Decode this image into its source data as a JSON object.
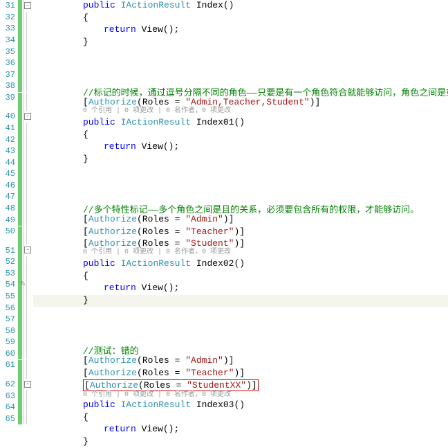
{
  "editor": {
    "lines": [
      {
        "num": 31,
        "type": "code",
        "indent": 2,
        "tokens": [
          [
            "kw",
            "public"
          ],
          [
            "punct",
            " "
          ],
          [
            "type",
            "IActionResult"
          ],
          [
            "punct",
            " "
          ],
          [
            "ident",
            "Index"
          ],
          [
            "punct",
            "()"
          ]
        ],
        "track": "green",
        "box": true
      },
      {
        "num": 32,
        "type": "code",
        "indent": 2,
        "tokens": [
          [
            "punct",
            "{"
          ]
        ],
        "track": "green"
      },
      {
        "num": 33,
        "type": "code",
        "indent": 3,
        "tokens": [
          [
            "kw",
            "return"
          ],
          [
            "punct",
            " "
          ],
          [
            "ident",
            "View"
          ],
          [
            "punct",
            "();"
          ]
        ],
        "track": "green"
      },
      {
        "num": 34,
        "type": "code",
        "indent": 2,
        "tokens": [
          [
            "punct",
            "}"
          ]
        ],
        "track": "green"
      },
      {
        "num": 35,
        "type": "blank",
        "track": "green"
      },
      {
        "num": 36,
        "type": "blank",
        "track": "green"
      },
      {
        "num": 37,
        "type": "blank",
        "track": "green"
      },
      {
        "num": 38,
        "type": "code",
        "indent": 2,
        "tokens": [
          [
            "comment",
            "//标记的时候，通过逗号分隔不同的角色——只要是有一个角色符合就能够访问，角色之间是或者的关系"
          ]
        ],
        "track": "green"
      },
      {
        "num": 39,
        "type": "code-lens",
        "indent": 2,
        "tokens": [
          [
            "punct",
            "["
          ],
          [
            "type",
            "Authorize"
          ],
          [
            "punct",
            "(Roles = "
          ],
          [
            "str",
            "\"Admin,Teacher,Student\""
          ],
          [
            "punct",
            ")]"
          ]
        ],
        "lens": "0 个引用 | 0 项更改 | 0 名作者，0 项更改",
        "track": "green"
      },
      {
        "num": 40,
        "type": "code",
        "indent": 2,
        "tokens": [
          [
            "kw",
            "public"
          ],
          [
            "punct",
            " "
          ],
          [
            "type",
            "IActionResult"
          ],
          [
            "punct",
            " "
          ],
          [
            "ident",
            "Index01"
          ],
          [
            "punct",
            "()"
          ]
        ],
        "track": "green",
        "box": true
      },
      {
        "num": 41,
        "type": "code",
        "indent": 2,
        "tokens": [
          [
            "punct",
            "{"
          ]
        ],
        "track": "green"
      },
      {
        "num": 42,
        "type": "code",
        "indent": 3,
        "tokens": [
          [
            "kw",
            "return"
          ],
          [
            "punct",
            " "
          ],
          [
            "ident",
            "View"
          ],
          [
            "punct",
            "();"
          ]
        ],
        "track": "green"
      },
      {
        "num": 43,
        "type": "code",
        "indent": 2,
        "tokens": [
          [
            "punct",
            "}"
          ]
        ],
        "track": "green"
      },
      {
        "num": 44,
        "type": "blank",
        "track": "green"
      },
      {
        "num": 45,
        "type": "blank",
        "track": "green"
      },
      {
        "num": 46,
        "type": "blank",
        "track": "green"
      },
      {
        "num": 47,
        "type": "code",
        "indent": 2,
        "tokens": [
          [
            "comment",
            "//多个特性标记——多个角色之间是且的关系，必须要包含所有的权限，才能够访问。"
          ]
        ],
        "track": "green"
      },
      {
        "num": 48,
        "type": "code",
        "indent": 2,
        "tokens": [
          [
            "punct",
            "["
          ],
          [
            "type",
            "Authorize"
          ],
          [
            "punct",
            "(Roles = "
          ],
          [
            "str",
            "\"Admin\""
          ],
          [
            "punct",
            ")]"
          ]
        ],
        "track": "green"
      },
      {
        "num": 49,
        "type": "code",
        "indent": 2,
        "tokens": [
          [
            "punct",
            "["
          ],
          [
            "type",
            "Authorize"
          ],
          [
            "punct",
            "(Roles = "
          ],
          [
            "str",
            "\"Teacher\""
          ],
          [
            "punct",
            ")]"
          ]
        ],
        "track": "green"
      },
      {
        "num": 50,
        "type": "code-lens",
        "indent": 2,
        "tokens": [
          [
            "punct",
            "["
          ],
          [
            "type",
            "Authorize"
          ],
          [
            "punct",
            "(Roles = "
          ],
          [
            "str",
            "\"Student\""
          ],
          [
            "punct",
            ")]"
          ]
        ],
        "lens": "0 个引用 | 0 项更改 | 0 名作者，0 项更改",
        "track": "green"
      },
      {
        "num": 51,
        "type": "code",
        "indent": 2,
        "tokens": [
          [
            "kw",
            "public"
          ],
          [
            "punct",
            " "
          ],
          [
            "type",
            "IActionResult"
          ],
          [
            "punct",
            " "
          ],
          [
            "ident",
            "Index02"
          ],
          [
            "punct",
            "()"
          ]
        ],
        "track": "green",
        "box": true
      },
      {
        "num": 52,
        "type": "code",
        "indent": 2,
        "tokens": [
          [
            "punct",
            "{"
          ]
        ],
        "track": "green"
      },
      {
        "num": 53,
        "type": "code",
        "indent": 3,
        "tokens": [
          [
            "kw",
            "return"
          ],
          [
            "punct",
            " "
          ],
          [
            "ident",
            "View"
          ],
          [
            "punct",
            "();"
          ]
        ],
        "track": "green"
      },
      {
        "num": 54,
        "type": "code",
        "indent": 2,
        "tokens": [
          [
            "punct",
            "}"
          ]
        ],
        "track": "green",
        "highlight": true,
        "pencil": true
      },
      {
        "num": 55,
        "type": "blank",
        "track": "green"
      },
      {
        "num": 56,
        "type": "blank",
        "track": "green"
      },
      {
        "num": 57,
        "type": "blank",
        "track": "green"
      },
      {
        "num": 58,
        "type": "code",
        "indent": 2,
        "tokens": [
          [
            "comment",
            "//测试：错的"
          ]
        ],
        "track": "green"
      },
      {
        "num": 59,
        "type": "code",
        "indent": 2,
        "tokens": [
          [
            "punct",
            "["
          ],
          [
            "type",
            "Authorize"
          ],
          [
            "punct",
            "(Roles = "
          ],
          [
            "str",
            "\"Admin\""
          ],
          [
            "punct",
            ")]"
          ]
        ],
        "track": "green"
      },
      {
        "num": 60,
        "type": "code",
        "indent": 2,
        "tokens": [
          [
            "punct",
            "["
          ],
          [
            "type",
            "Authorize"
          ],
          [
            "punct",
            "(Roles = "
          ],
          [
            "str",
            "\"Teacher\""
          ],
          [
            "punct",
            ")]"
          ]
        ],
        "track": "green"
      },
      {
        "num": 61,
        "type": "code-lens",
        "indent": 2,
        "redbox": true,
        "tokens": [
          [
            "punct",
            "["
          ],
          [
            "type",
            "Authorize"
          ],
          [
            "punct",
            "(Roles = "
          ],
          [
            "str",
            "\"StudentXX\""
          ],
          [
            "punct",
            ")]"
          ]
        ],
        "lens": "0 个引用 | 0 项更改 | 0 名作者，0 项更改",
        "track": "green"
      },
      {
        "num": 62,
        "type": "code",
        "indent": 2,
        "tokens": [
          [
            "kw",
            "public"
          ],
          [
            "punct",
            " "
          ],
          [
            "type",
            "IActionResult"
          ],
          [
            "punct",
            " "
          ],
          [
            "ident",
            "Index03"
          ],
          [
            "punct",
            "()"
          ]
        ],
        "track": "green",
        "box": true
      },
      {
        "num": 63,
        "type": "code",
        "indent": 2,
        "tokens": [
          [
            "punct",
            "{"
          ]
        ],
        "track": "green"
      },
      {
        "num": 64,
        "type": "code",
        "indent": 3,
        "tokens": [
          [
            "kw",
            "return"
          ],
          [
            "punct",
            " "
          ],
          [
            "ident",
            "View"
          ],
          [
            "punct",
            "();"
          ]
        ],
        "track": "green"
      },
      {
        "num": 65,
        "type": "code",
        "indent": 2,
        "tokens": [
          [
            "punct",
            "}"
          ]
        ],
        "track": "green"
      }
    ]
  }
}
